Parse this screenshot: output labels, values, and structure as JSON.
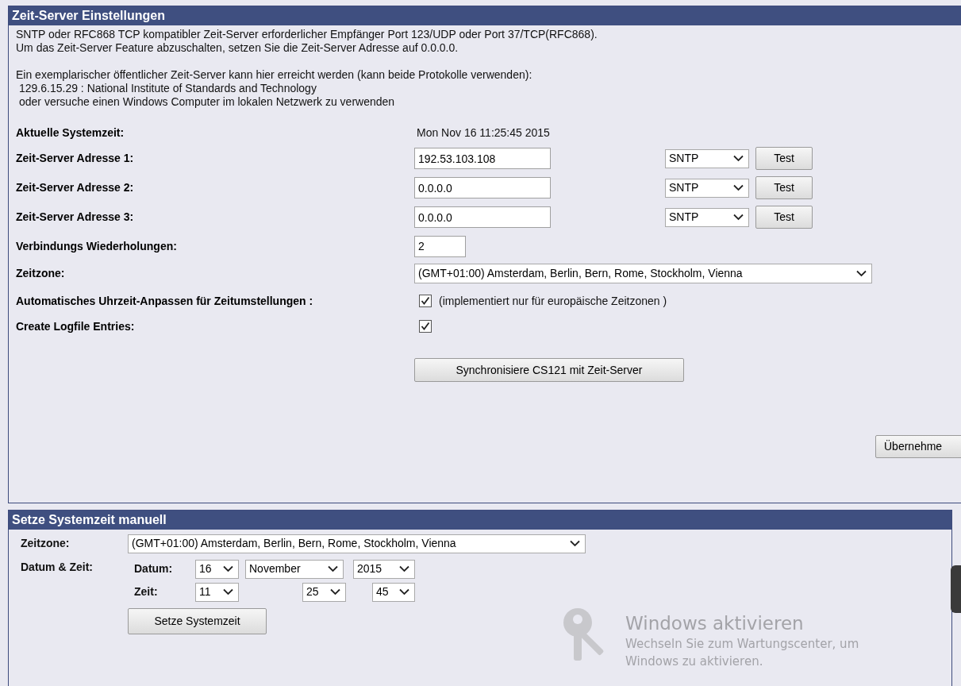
{
  "time_server": {
    "title": "Zeit-Server Einstellungen",
    "intro": [
      [
        {
          "text": "SNTP oder RFC868 TCP kompatibler Zeit-Server erforderlicher Empfänger Port 123/UDP oder Port 37/TCP(RFC868).",
          "kind": "plain"
        },
        {
          "text": "Um das Zeit-Server Feature abzuschalten, setzen Sie die Zeit-Server Adresse auf 0.0.0.0.",
          "kind": "plain"
        }
      ],
      [
        {
          "text": "Ein exemplarischer öffentlicher Zeit-Server kann hier erreicht werden (kann beide Protokolle verwenden):",
          "kind": "plain"
        },
        {
          "text": "129.6.15.29 : National Institute of Standards and Technology",
          "kind": "indented"
        },
        {
          "text": "oder versuche einen Windows Computer im lokalen Netzwerk zu verwenden",
          "kind": "indented"
        }
      ]
    ],
    "current_time": {
      "label": "Aktuelle Systemzeit:",
      "value": "Mon Nov 16 11:25:45 2015"
    },
    "servers": [
      {
        "label": "Zeit-Server Adresse 1:",
        "address": "192.53.103.108",
        "protocol": "SNTP",
        "test": "Test"
      },
      {
        "label": "Zeit-Server Adresse 2:",
        "address": "0.0.0.0",
        "protocol": "SNTP",
        "test": "Test"
      },
      {
        "label": "Zeit-Server Adresse 3:",
        "address": "0.0.0.0",
        "protocol": "SNTP",
        "test": "Test"
      }
    ],
    "retries": {
      "label": "Verbindungs Wiederholungen:",
      "value": "2"
    },
    "timezone": {
      "label": "Zeitzone:",
      "value": "(GMT+01:00) Amsterdam, Berlin, Bern, Rome, Stockholm, Vienna"
    },
    "auto_dst": {
      "label": "Automatisches Uhrzeit-Anpassen für Zeitumstellungen :",
      "checked": true,
      "note": "(implementiert nur für europäische Zeitzonen )"
    },
    "logfile": {
      "label": "Create Logfile Entries:",
      "checked": true
    },
    "sync_button": "Synchronisiere CS121 mit Zeit-Server",
    "apply_button": "Übernehme"
  },
  "manual": {
    "title": "Setze Systemzeit manuell",
    "timezone": {
      "label": "Zeitzone:",
      "value": "(GMT+01:00) Amsterdam, Berlin, Bern, Rome, Stockholm, Vienna"
    },
    "datetime_label": "Datum & Zeit:",
    "date": {
      "label": "Datum:",
      "day": "16",
      "month": "November",
      "year": "2015"
    },
    "time": {
      "label": "Zeit:",
      "hour": "11",
      "minute": "25",
      "second": "45"
    },
    "set_button": "Setze Systemzeit"
  },
  "activation_notice": {
    "title": "Windows aktivieren",
    "lines": [
      "Wechseln Sie zum Wartungscenter, um",
      "Windows zu aktivieren."
    ]
  }
}
